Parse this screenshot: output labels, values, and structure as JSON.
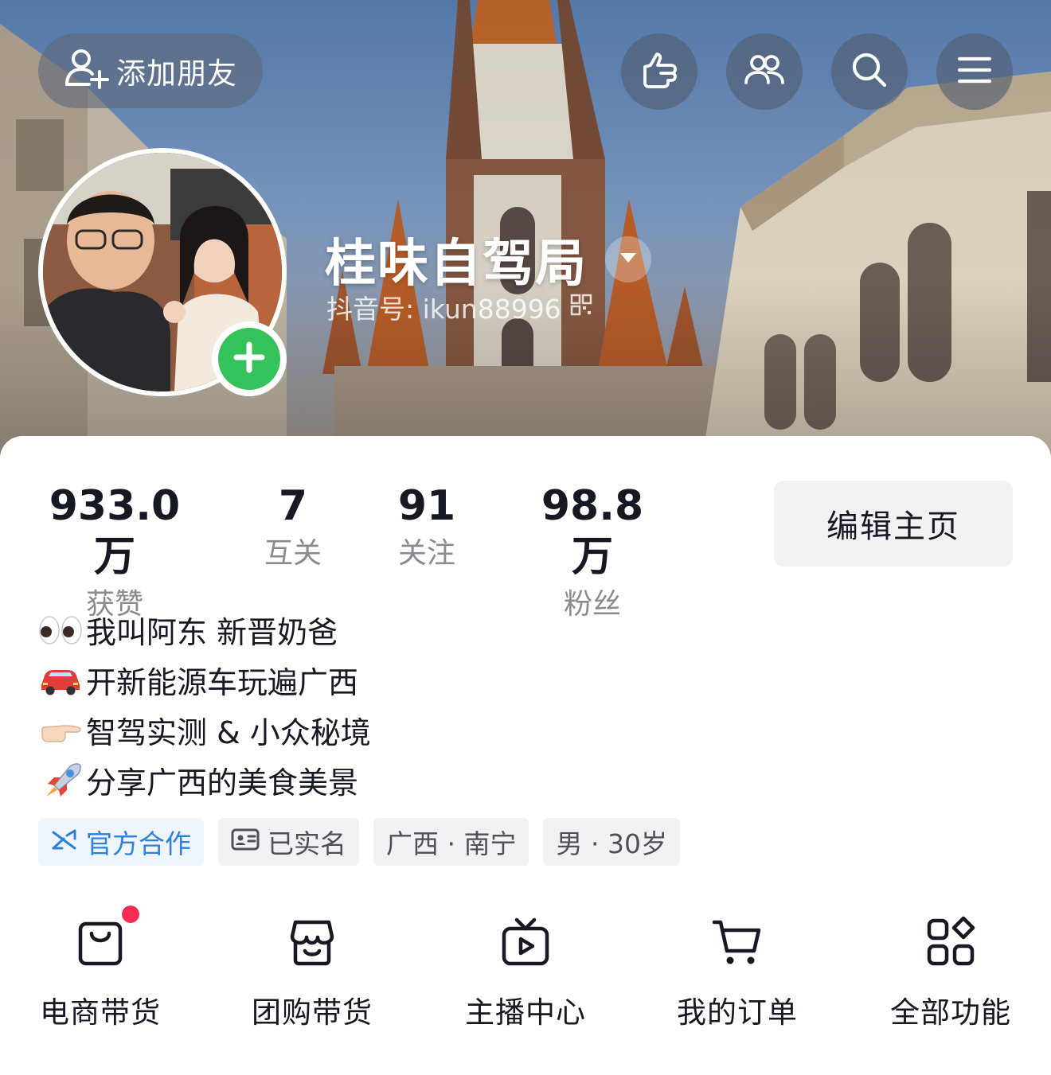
{
  "header": {
    "add_friend_label": "添加朋友",
    "nickname": "桂味自驾局",
    "douyin_id_label": "抖音号: ikun88996",
    "buttons": [
      "pointing-hand-icon",
      "friends-icon",
      "search-icon",
      "menu-icon"
    ]
  },
  "stats": [
    {
      "value": "933.0万",
      "label": "获赞"
    },
    {
      "value": "7",
      "label": "互关"
    },
    {
      "value": "91",
      "label": "关注"
    },
    {
      "value": "98.8万",
      "label": "粉丝"
    }
  ],
  "edit_profile_label": "编辑主页",
  "bio": [
    {
      "emoji": "eyes",
      "text": "我叫阿东 新晋奶爸"
    },
    {
      "emoji": "car",
      "text": "开新能源车玩遍广西"
    },
    {
      "emoji": "pointing-right",
      "text": "智驾实测 & 小众秘境"
    },
    {
      "emoji": "rocket",
      "text": "分享广西的美食美景"
    }
  ],
  "tags": [
    {
      "label": "官方合作",
      "icon": "official-cooperation-icon"
    },
    {
      "label": "已实名",
      "icon": "id-card-icon"
    },
    {
      "label": "广西 · 南宁"
    },
    {
      "label": "男 · 30岁"
    }
  ],
  "tools": [
    {
      "label": "电商带货",
      "icon": "shopping-bag-icon",
      "has_dot": true
    },
    {
      "label": "团购带货",
      "icon": "store-icon",
      "has_dot": false
    },
    {
      "label": "主播中心",
      "icon": "tv-play-icon",
      "has_dot": false
    },
    {
      "label": "我的订单",
      "icon": "cart-icon",
      "has_dot": false
    },
    {
      "label": "全部功能",
      "icon": "apps-grid-icon",
      "has_dot": false
    }
  ],
  "colors": {
    "accent_green": "#36c25a",
    "notification_red": "#fe2c55",
    "official_blue": "#2f7fde"
  }
}
